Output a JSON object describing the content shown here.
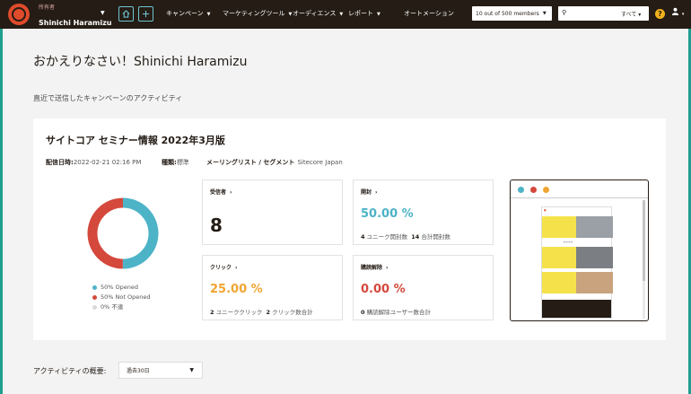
{
  "topbar": {
    "account_label": "所有者",
    "account_name": "Shinichi Haramizu",
    "nav": [
      "キャンペーン",
      "マーケティングツール",
      "オーディエンス",
      "レポート",
      "オートメーション"
    ],
    "members_label": "10 out of 500 members",
    "search_placeholder": "",
    "search_scope": "すべて"
  },
  "welcome": "おかえりなさい！Shinichi Haramizu",
  "recent_heading": "直近で送信したキャンペーンのアクティビティ",
  "campaign": {
    "title": "サイトコア セミナー情報 2022年3月版",
    "sent_label": "配信日時:",
    "sent_value": "2022-02-21 02:16 PM",
    "type_label": "種類:",
    "type_value": "標準",
    "list_label": "メーリングリスト / セグメント",
    "list_value": "Sitecore Japan"
  },
  "donut": {
    "opened_pct": 50,
    "not_opened_pct": 50,
    "bounced_pct": 0,
    "legend": [
      "50% Opened",
      "50% Not Opened",
      "0% 不達"
    ],
    "colors": {
      "opened": "#4db3c7",
      "not_opened": "#d4493c",
      "bounced": "#d8d8d8"
    }
  },
  "stats": {
    "recipients": {
      "label": "受信者",
      "value": "8"
    },
    "opens": {
      "label": "開封",
      "value": "50.00 %",
      "unique_count": "4",
      "unique_label": "ユニーク開封数",
      "total_count": "14",
      "total_label": "合計開封数",
      "color": "#4db3c7"
    },
    "clicks": {
      "label": "クリック",
      "value": "25.00 %",
      "unique_count": "2",
      "unique_label": "ユニーククリック",
      "total_count": "2",
      "total_label": "クリック数合計",
      "color": "#f0a531"
    },
    "unsubscribes": {
      "label": "購読解除",
      "value": "0.00 %",
      "count": "0",
      "count_label": "購読解除ユーザー数合計",
      "color": "#d4493c"
    }
  },
  "overview": {
    "label": "アクティビティの概要:",
    "period": "過去30日"
  }
}
